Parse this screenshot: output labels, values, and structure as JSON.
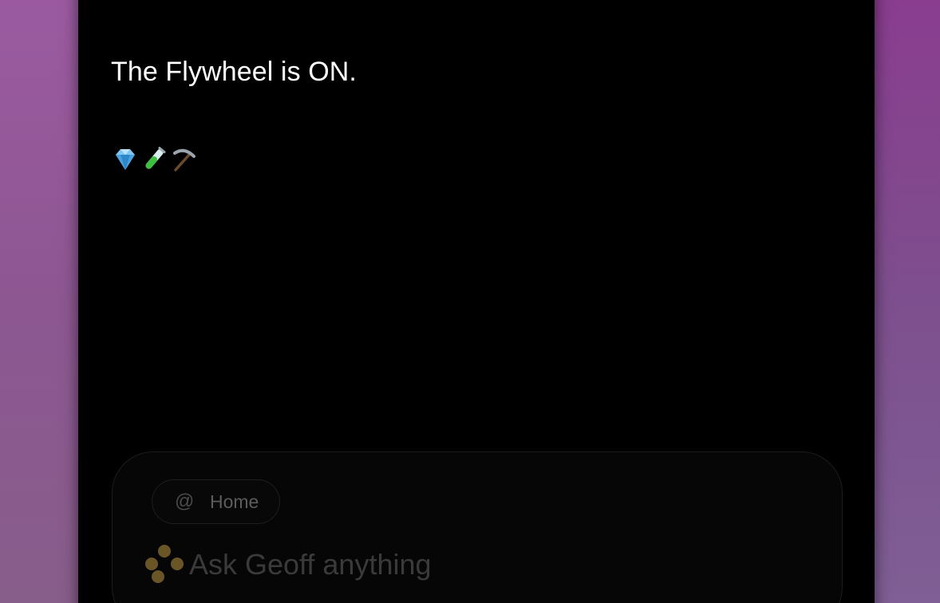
{
  "message": {
    "text": "The Flywheel is ON.",
    "emoji_icons": [
      "gem-icon",
      "test-tube-icon",
      "pick-icon"
    ]
  },
  "composer": {
    "context_chip": {
      "symbol": "@",
      "label": "Home"
    },
    "prompt_placeholder": "Ask Geoff anything",
    "logo_icon": "geoff-dots-icon"
  },
  "colors": {
    "background_gradient": "#8a4f93",
    "panel": "#000000",
    "composer_bg": "#060606",
    "logo_dots": "#6a5527"
  }
}
